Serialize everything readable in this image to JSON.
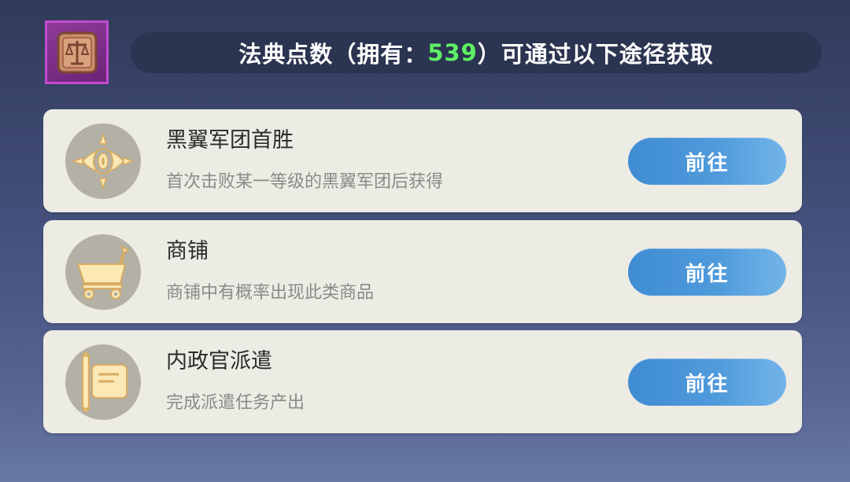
{
  "header": {
    "prefix": "法典点数（拥有：",
    "count": "539",
    "suffix": "）可通过以下途径获取",
    "item_icon": "codex-tablet-icon"
  },
  "colors": {
    "count_highlight": "#5ef064",
    "button_blue": "#4a95d8",
    "card_bg": "#ecebe4",
    "badge_border": "#c24bd0"
  },
  "sources": [
    {
      "title": "黑翼军团首胜",
      "description": "首次击败某一等级的黑翼军团后获得",
      "icon": "eye-emblem-icon",
      "button_label": "前往"
    },
    {
      "title": "商铺",
      "description": "商铺中有概率出现此类商品",
      "icon": "shopping-cart-icon",
      "button_label": "前往"
    },
    {
      "title": "内政官派遣",
      "description": "完成派遣任务产出",
      "icon": "scroll-icon",
      "button_label": "前往"
    }
  ]
}
